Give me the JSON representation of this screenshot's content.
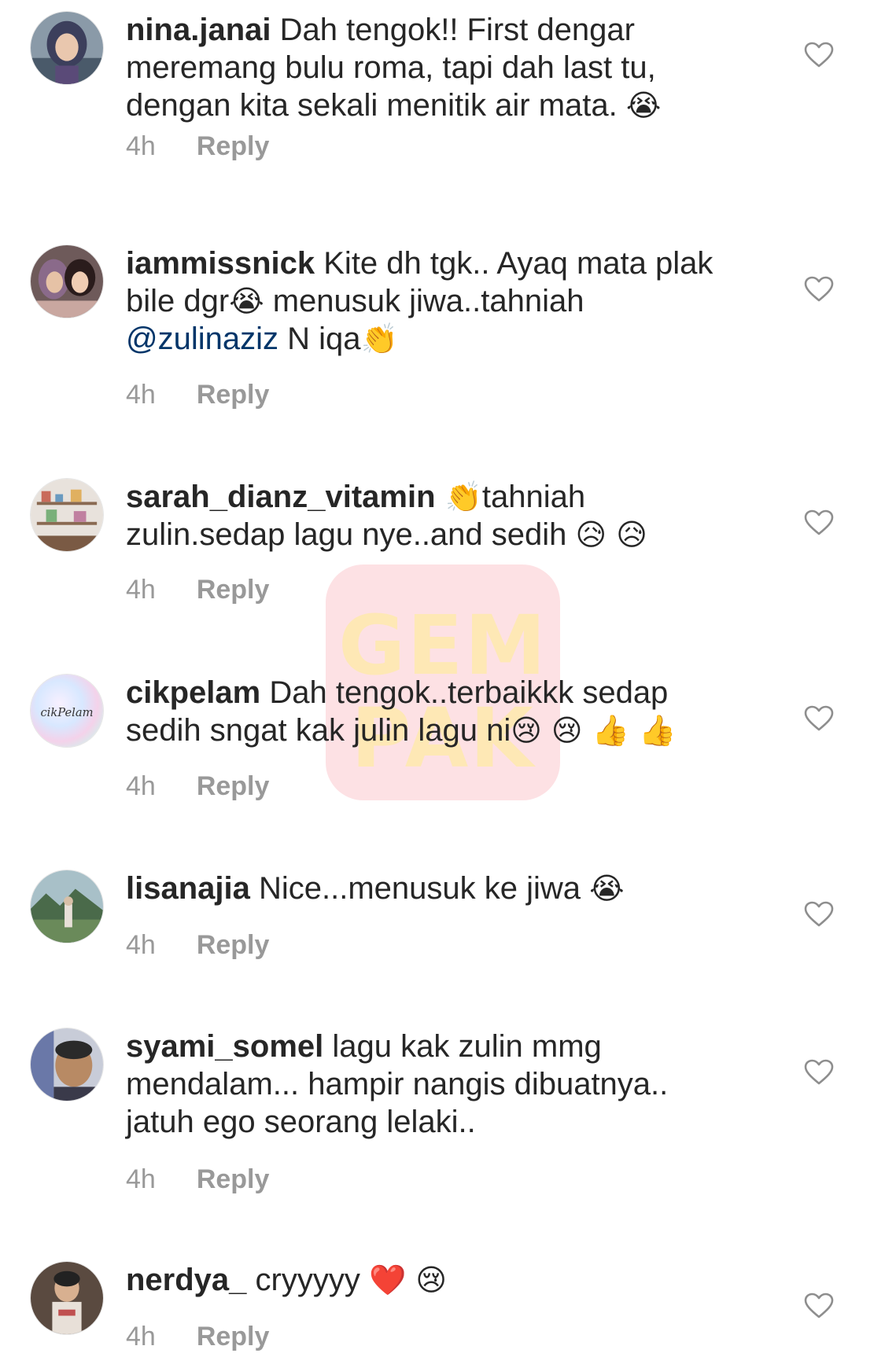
{
  "watermark": {
    "line1": "GEM",
    "line2": "PAK"
  },
  "colors": {
    "username": "#262626",
    "text": "#262626",
    "meta": "#999999",
    "mention": "#003569",
    "heart_outline": "#8e8e8e"
  },
  "comments": [
    {
      "username": "nina.janai",
      "text": " Dah tengok!! First dengar meremang bulu roma, tapi dah last tu, dengan kita sekali menitik air mata. ",
      "emoji": "😭",
      "time": "4h",
      "reply": "Reply",
      "avatar_icon": "profile-photo-hijab"
    },
    {
      "username": "iammissnick",
      "text1": " Kite dh tgk.. Ayaq mata plak bile dgr",
      "emoji1": "😭",
      "text2": " menusuk jiwa..tahniah ",
      "mention": "@zulinaziz",
      "text3": " N iqa",
      "emoji2": "👏",
      "time": "4h",
      "reply": "Reply",
      "avatar_icon": "profile-photo-two-women"
    },
    {
      "username": "sarah_dianz_vitamin",
      "emoji1": " 👏",
      "text1": "tahniah zulin.sedap lagu nye..and sedih ",
      "emoji2": "😥 😥",
      "time": "4h",
      "reply": "Reply",
      "avatar_icon": "profile-photo-shelf"
    },
    {
      "username": "cikpelam",
      "text": " Dah tengok..terbaikkk sedap sedih sngat kak julin lagu ni",
      "emoji": "😢 😢 👍 👍",
      "avatar_text": "cikPelam",
      "time": "4h",
      "reply": "Reply",
      "avatar_icon": "profile-photo-pastel-logo"
    },
    {
      "username": "lisanajia",
      "text": " Nice...menusuk ke jiwa ",
      "emoji": "😭",
      "time": "4h",
      "reply": "Reply",
      "avatar_icon": "profile-photo-landscape"
    },
    {
      "username": "syami_somel",
      "text": " lagu kak zulin mmg mendalam... hampir nangis dibuatnya.. jatuh ego seorang lelaki..",
      "time": "4h",
      "reply": "Reply",
      "avatar_icon": "profile-photo-man"
    },
    {
      "username": "nerdya_",
      "text": " cryyyyy ",
      "emoji": "❤️ 😢",
      "time": "4h",
      "reply": "Reply",
      "avatar_icon": "profile-photo-girl"
    }
  ]
}
